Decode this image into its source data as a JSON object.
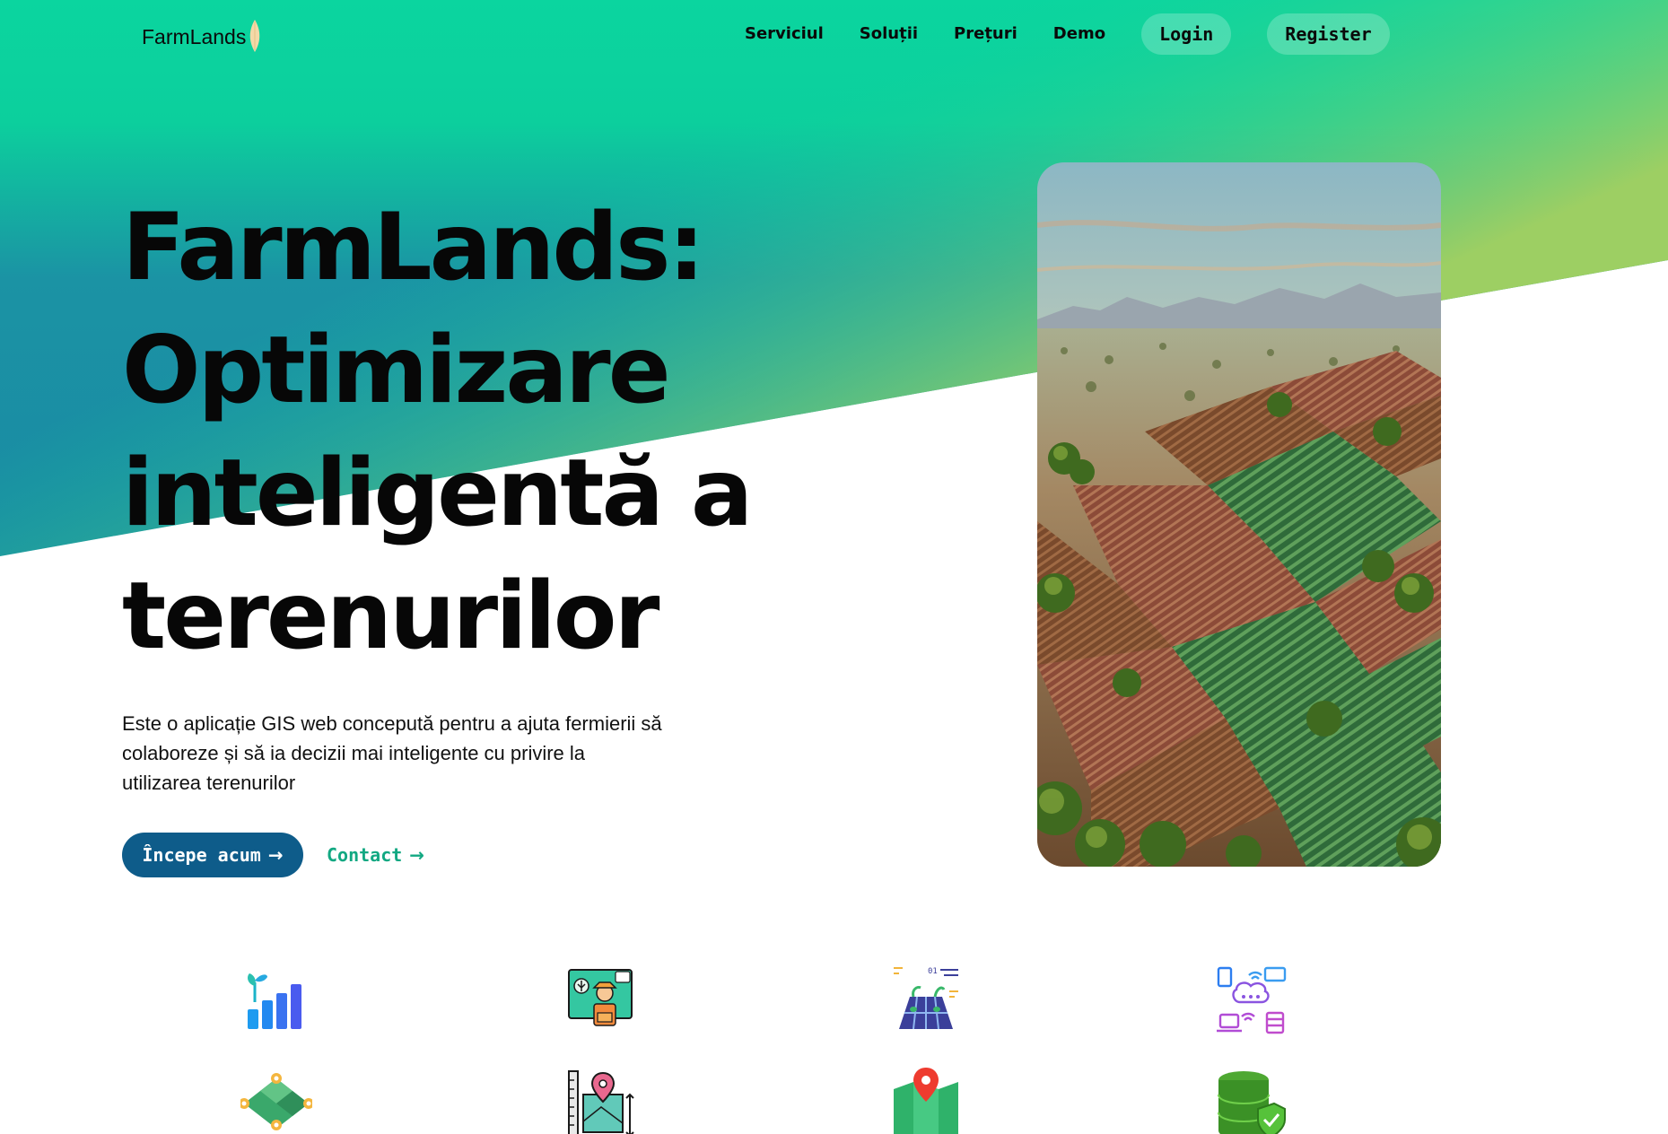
{
  "nav": {
    "logo_text": "FarmLands",
    "links": [
      "Serviciul",
      "Soluții",
      "Prețuri",
      "Demo"
    ],
    "login_label": "Login",
    "register_label": "Register"
  },
  "hero": {
    "title_line1": "FarmLands:",
    "title_line2": "Optimizare",
    "title_line3": "inteligentă a",
    "title_line4": "terenurilor",
    "description": "Este o aplicație GIS web concepută pentru a ajuta fermierii să colaboreze și să ia decizii mai inteligente cu privire la utilizarea terenurilor",
    "primary_cta": "Începe acum",
    "secondary_cta": "Contact",
    "arrow": "→"
  },
  "features": {
    "icons": [
      "growth-chart-icon",
      "farmer-presentation-icon",
      "solar-farm-data-icon",
      "cloud-network-icon",
      "land-parcel-pins-icon",
      "map-measure-icon",
      "map-location-icon",
      "database-secure-icon"
    ]
  },
  "colors": {
    "gradient_top": "#0bd59f",
    "gradient_bottom": "#1990a4",
    "gradient_corner": "#8fd16a",
    "primary_button": "#0e5c8a",
    "accent": "#12a882"
  }
}
